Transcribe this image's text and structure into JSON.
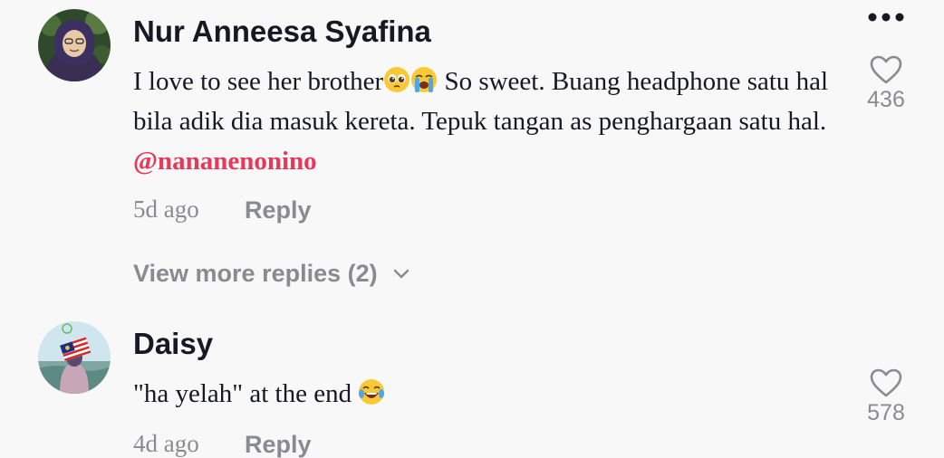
{
  "comments": [
    {
      "username": "Nur Anneesa Syafina",
      "text_before_emoji": "I love to see her brother",
      "emojis": [
        "pleading-face-emoji",
        "loudly-crying-face-emoji"
      ],
      "text_after_emoji": " So sweet. Buang headphone satu hal bila adik dia masuk kereta. Tepuk tangan as penghargaan satu hal. ",
      "mention": "@nananenonino",
      "timestamp": "5d ago",
      "reply_label": "Reply",
      "like_count": "436",
      "view_more_label": "View more replies (2)"
    },
    {
      "username": "Daisy",
      "text_before_emoji": "\"ha yelah\" at the end ",
      "emojis": [
        "tears-of-joy-emoji"
      ],
      "timestamp": "4d ago",
      "reply_label": "Reply",
      "like_count": "578"
    }
  ],
  "icons": {
    "more": "more-dots-icon",
    "like": "heart-outline-icon",
    "expand": "chevron-down-icon"
  },
  "colors": {
    "background": "#f8f8f8",
    "text": "#161823",
    "secondary": "#8a8b91",
    "mention": "#e8385a"
  }
}
